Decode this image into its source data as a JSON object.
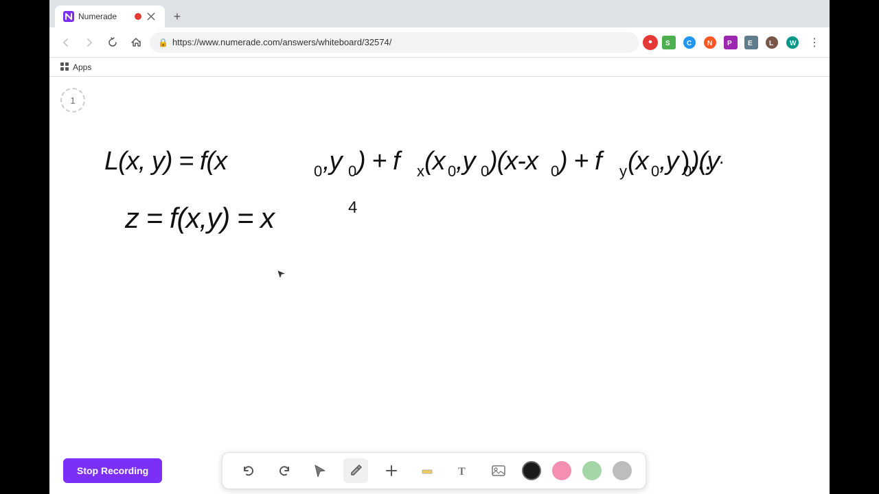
{
  "browser": {
    "tab": {
      "title": "Numerade",
      "url": "https://www.numerade.com/answers/whiteboard/32574/",
      "favicon_color": "#e53935"
    },
    "bookmarks": {
      "apps_label": "Apps"
    }
  },
  "toolbar": {
    "stop_recording_label": "Stop Recording",
    "tools": [
      {
        "id": "undo",
        "icon": "↺",
        "label": "Undo"
      },
      {
        "id": "redo",
        "icon": "↻",
        "label": "Redo"
      },
      {
        "id": "select",
        "icon": "▶",
        "label": "Select"
      },
      {
        "id": "pen",
        "icon": "✏",
        "label": "Pen"
      },
      {
        "id": "add",
        "icon": "+",
        "label": "Add"
      },
      {
        "id": "highlighter",
        "icon": "/",
        "label": "Highlighter"
      },
      {
        "id": "text",
        "icon": "T",
        "label": "Text"
      },
      {
        "id": "image",
        "icon": "🖼",
        "label": "Image"
      }
    ],
    "colors": [
      {
        "id": "black",
        "value": "#1a1a1a",
        "selected": true
      },
      {
        "id": "pink",
        "value": "#f48fb1"
      },
      {
        "id": "green",
        "value": "#a5d6a7"
      },
      {
        "id": "gray",
        "value": "#bdbdbd"
      }
    ]
  },
  "page": {
    "number": "1"
  },
  "math": {
    "line1": "L(x,y) = f(x₀,y₀) + fx(x₀,y₀)(x-x₀) + fy(x₀,y₀)(y-y₀) ...",
    "line2": "z = f(x,y) = x⁴"
  },
  "recording": {
    "status": "Recording"
  }
}
